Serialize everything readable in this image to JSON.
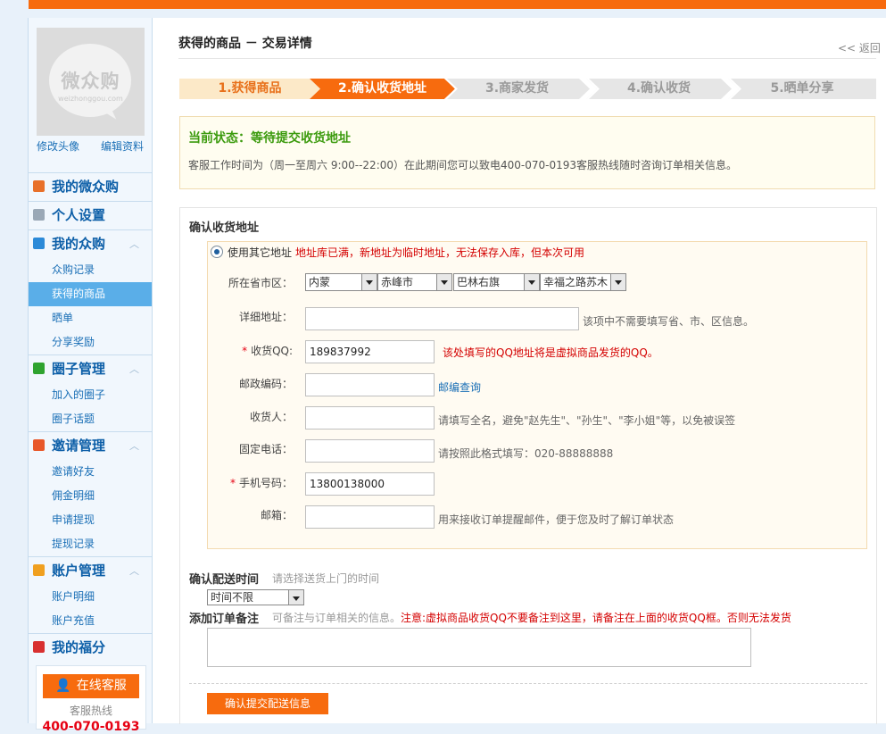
{
  "sidebar": {
    "avatar_logo_cn": "微众购",
    "avatar_logo_en": "weizhonggou.com",
    "edit_avatar": "修改头像",
    "edit_profile": "编辑资料",
    "groups": [
      {
        "label": "我的微众购",
        "icon": "home-icon",
        "color": "#e8702a"
      },
      {
        "label": "个人设置",
        "icon": "gear-icon",
        "color": "#9aa8b6"
      },
      {
        "label": "我的众购",
        "icon": "cart-icon",
        "color": "#2c8ad8",
        "items": [
          "众购记录",
          "获得的商品",
          "晒单",
          "分享奖励"
        ],
        "active": "获得的商品"
      },
      {
        "label": "圈子管理",
        "icon": "circle-icon",
        "color": "#2fa32f",
        "items": [
          "加入的圈子",
          "圈子话题"
        ]
      },
      {
        "label": "邀请管理",
        "icon": "invite-icon",
        "color": "#e8582a",
        "items": [
          "邀请好友",
          "佣金明细",
          "申请提现",
          "提现记录"
        ]
      },
      {
        "label": "账户管理",
        "icon": "yen-icon",
        "color": "#f0a020",
        "items": [
          "账户明细",
          "账户充值"
        ]
      },
      {
        "label": "我的福分",
        "icon": "fortune-icon",
        "color": "#d83030"
      }
    ],
    "support_button": "在线客服",
    "support_hotline_label": "客服热线",
    "support_phone": "400-070-0193"
  },
  "header": {
    "title": "获得的商品 － 交易详情",
    "back": "<< 返回"
  },
  "steps": [
    "1.获得商品",
    "2.确认收货地址",
    "3.商家发货",
    "4.确认收货",
    "5.晒单分享"
  ],
  "status": {
    "label": "当前状态：等待提交收货地址",
    "description": "客服工作时间为（周一至周六 9:00--22:00）在此期间您可以致电400-070-0193客服热线随时咨询订单相关信息。"
  },
  "address": {
    "section_title": "确认收货地址",
    "radio_label": "使用其它地址",
    "radio_warning": "地址库已满，新地址为临时地址，无法保存入库，但本次可用",
    "region_label": "所在省市区：",
    "region": {
      "province": "内蒙",
      "city": "赤峰市",
      "district": "巴林右旗",
      "street": "幸福之路苏木"
    },
    "detail_label": "详细地址：",
    "detail_value": "",
    "detail_hint": "该项中不需要填写省、市、区信息。",
    "qq_label": "收货QQ:",
    "qq_value": "189837992",
    "qq_hint": "该处填写的QQ地址将是虚拟商品发货的QQ。",
    "zip_label": "邮政编码：",
    "zip_value": "",
    "zip_link": "邮编查询",
    "name_label": "收货人：",
    "name_value": "",
    "name_hint": "请填写全名，避免\"赵先生\"、\"孙生\"、\"李小姐\"等，以免被误签",
    "phone_label": "固定电话：",
    "phone_value": "",
    "phone_hint": "请按照此格式填写：020-88888888",
    "mobile_label": "手机号码：",
    "mobile_value": "13800138000",
    "email_label": "邮箱：",
    "email_value": "",
    "email_hint": "用来接收订单提醒邮件，便于您及时了解订单状态",
    "required_mark": "*"
  },
  "delivery": {
    "title": "确认配送时间",
    "hint": "请选择送货上门的时间",
    "selected": "时间不限"
  },
  "note": {
    "title": "添加订单备注",
    "hint": "可备注与订单相关的信息。",
    "warning": "注意:虚拟商品收货QQ不要备注到这里，请备注在上面的收货QQ框。否则无法发货",
    "value": ""
  },
  "submit_label": "确认提交配送信息"
}
